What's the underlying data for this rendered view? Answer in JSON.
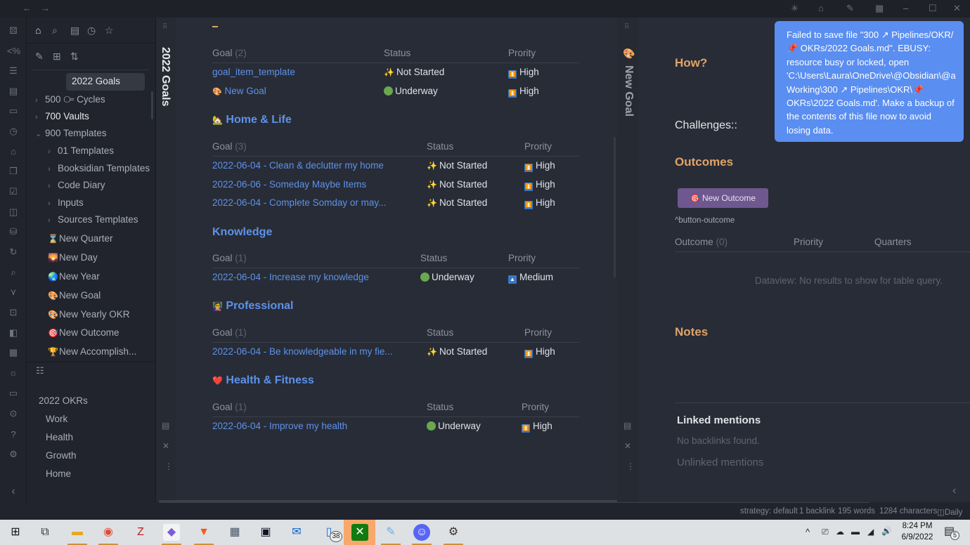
{
  "titlebar": {
    "back_icon": "arrow-left-icon",
    "forward_icon": "arrow-right-icon",
    "right_icons": [
      "loading-spinner-icon",
      "home-icon",
      "feather-icon",
      "calendar-icon"
    ],
    "window_controls": [
      "minimize",
      "maximize",
      "close"
    ]
  },
  "ribbon": {
    "icons": [
      "random-note-icon",
      "templater-icon",
      "outline-list-icon",
      "calendar-dollar-icon",
      "book-icon",
      "clock-icon",
      "home-house-icon",
      "copy-icon",
      "clipboard-check-icon",
      "kanban-icon",
      "database-icon",
      "sync-icon",
      "file-search-icon",
      "graph-icon",
      "terminal-icon",
      "layout-icon",
      "calendar-grid-icon",
      "lightbulb-icon",
      "tv-icon",
      "vault-icon",
      "help-icon",
      "settings-icon"
    ],
    "collapse_icon": "chevron-left-icon"
  },
  "left_panel": {
    "top_tabs": [
      "home-icon",
      "search-icon",
      "bookmark-icon",
      "recent-icon",
      "star-icon"
    ],
    "actions": [
      "new-note-icon",
      "new-folder-icon",
      "sort-icon"
    ],
    "selected_file": "2022 Goals",
    "tree": [
      {
        "label": "500 ⧃ Cycles",
        "chevron": ">"
      },
      {
        "label": "700 Vaults",
        "chevron": ">",
        "bold": true
      },
      {
        "label": "900 Templates",
        "chevron": "v"
      },
      {
        "label": "01 Templates",
        "chevron": ">"
      },
      {
        "label": "Booksidian Templates",
        "chevron": ">"
      },
      {
        "label": "Code Diary",
        "chevron": ">"
      },
      {
        "label": "Inputs",
        "chevron": ">"
      },
      {
        "label": "Sources Templates",
        "chevron": ">"
      },
      {
        "label": "New Quarter",
        "emoji": "⌛"
      },
      {
        "label": "New Day",
        "emoji": "🌄"
      },
      {
        "label": "New Year",
        "emoji": "🌏"
      },
      {
        "label": "New Goal",
        "emoji": "🎨"
      },
      {
        "label": "New Yearly OKR",
        "emoji": "🎨"
      },
      {
        "label": "New Outcome",
        "emoji": "🎯"
      },
      {
        "label": "New Accomplish...",
        "emoji": "🏆"
      }
    ],
    "outline_icon": "list-icon",
    "outline": {
      "title": "2022 OKRs",
      "items": [
        "Work",
        "Health",
        "Growth",
        "Home"
      ]
    }
  },
  "main": {
    "vertical_title": "2022 Goals",
    "sections": [
      {
        "heading": "",
        "col_goal": "Goal",
        "count": "(2)",
        "col_status": "Status",
        "col_priority": "Prority",
        "rows": [
          {
            "goal": "goal_item_template",
            "emoji": "",
            "status": "Not Started",
            "status_type": "sparkle",
            "priority": "High"
          },
          {
            "goal": "New Goal",
            "emoji": "🎨",
            "status": "Underway",
            "status_type": "dot",
            "priority": "High"
          }
        ]
      },
      {
        "heading": "Home & Life",
        "heading_emoji": "🏡",
        "col_goal": "Goal",
        "count": "(3)",
        "col_status": "Status",
        "col_priority": "Prority",
        "rows": [
          {
            "goal": "2022-06-04 - Clean & declutter my home",
            "status": "Not Started",
            "status_type": "sparkle",
            "priority": "High"
          },
          {
            "goal": "2022-06-06 - Someday Maybe Items",
            "status": "Not Started",
            "status_type": "sparkle",
            "priority": "High"
          },
          {
            "goal": "2022-06-04 - Complete Somday or may...",
            "status": "Not Started",
            "status_type": "sparkle",
            "priority": "High"
          }
        ]
      },
      {
        "heading": "Knowledge",
        "heading_emoji": "",
        "col_goal": "Goal",
        "count": "(1)",
        "col_status": "Status",
        "col_priority": "Prority",
        "rows": [
          {
            "goal": "2022-06-04 - Increase my knowledge",
            "status": "Underway",
            "status_type": "dot",
            "priority": "Medium"
          }
        ]
      },
      {
        "heading": "Professional",
        "heading_emoji": "👩‍🏫",
        "col_goal": "Goal",
        "count": "(1)",
        "col_status": "Status",
        "col_priority": "Prority",
        "rows": [
          {
            "goal": "2022-06-04 - Be knowledgeable in my fie...",
            "status": "Not Started",
            "status_type": "sparkle",
            "priority": "High"
          }
        ]
      },
      {
        "heading": "Health & Fitness",
        "heading_emoji": "❤️",
        "col_goal": "Goal",
        "count": "(1)",
        "col_status": "Status",
        "col_priority": "Prority",
        "rows": [
          {
            "goal": "2022-06-04 - Improve my health",
            "status": "Underway",
            "status_type": "dot",
            "priority": "High"
          }
        ]
      }
    ],
    "side_icons": [
      "drag-handle-icon",
      "reading-view-icon",
      "close-icon",
      "more-options-icon"
    ]
  },
  "right": {
    "vertical_title": "New Goal",
    "title_emoji": "🎨",
    "how_heading": "How?",
    "challenges_label": "Challenges::",
    "outcomes_heading": "Outcomes",
    "new_outcome_button": "New Outcome",
    "button_emoji": "🎯",
    "block_ref": "^button-outcome",
    "table": {
      "col_outcome": "Outcome",
      "count": "(0)",
      "col_priority": "Priority",
      "col_quarters": "Quarters"
    },
    "empty_message": "Dataview: No results to show for table query.",
    "notes_heading": "Notes",
    "linked_mentions": "Linked mentions",
    "no_backlinks": "No backlinks found.",
    "unlinked_mentions": "Unlinked mentions"
  },
  "toast": {
    "message": "Failed to save file \"300 ↗ Pipelines/OKR/ 📌 OKRs/2022 Goals.md\". EBUSY: resource busy or locked, open 'C:\\Users\\Laura\\OneDrive\\@Obsidian\\@a Working\\300 ↗ Pipelines\\OKR\\📌 OKRs\\2022 Goals.md'. Make a backup of the contents of this file now to avoid losing data."
  },
  "statusbar": {
    "strategy": "strategy: default",
    "backlinks": "1 backlink",
    "words": "195 words",
    "characters": "1284 characters",
    "daily": "Daily"
  },
  "taskbar": {
    "apps": [
      "start",
      "task-view",
      "file-explorer",
      "chrome",
      "zotero",
      "obsidian",
      "brave",
      "calculator",
      "kindle",
      "outlook",
      "phone-link",
      "xbox",
      "notepad",
      "discord",
      "settings"
    ],
    "badge_count": "38",
    "time": "8:24 PM",
    "date": "6/9/2022",
    "notification_count": "5"
  },
  "colors": {
    "link": "#5d92ea",
    "accent_heading": "#e0a46a",
    "toast": "#5a8ef0",
    "button": "#6f578f"
  }
}
